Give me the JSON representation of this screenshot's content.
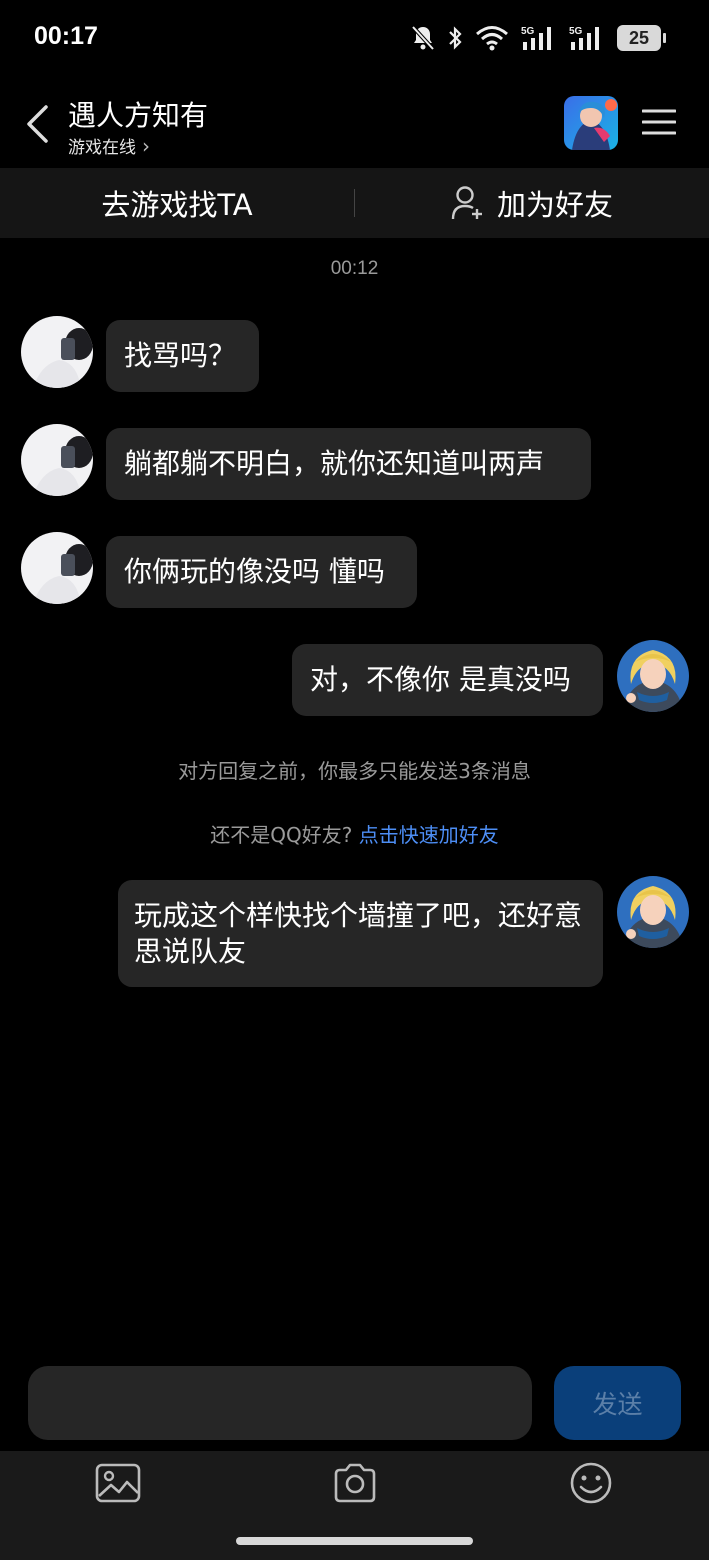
{
  "status_bar": {
    "time": "00:17",
    "battery": "25",
    "icons": [
      "bell-muted-icon",
      "bluetooth-icon",
      "wifi-icon",
      "signal-5g-icon",
      "signal-5g-icon",
      "battery-icon"
    ]
  },
  "header": {
    "title": "遇人方知有",
    "subtitle": "游戏在线",
    "subtitle_chevron": "›"
  },
  "actions": {
    "find_in_game": "去游戏找TA",
    "add_friend": "加为好友"
  },
  "chat": {
    "timestamp": "00:12",
    "messages": [
      {
        "side": "left",
        "text": "找骂吗？"
      },
      {
        "side": "left",
        "text": "躺都躺不明白，就你还知道叫两声"
      },
      {
        "side": "left",
        "text": "你俩玩的像没吗 懂吗"
      },
      {
        "side": "right",
        "text": "对，不像你 是真没吗"
      },
      {
        "side": "right",
        "text": "玩成这个样快找个墙撞了吧，还好意思说队友"
      }
    ],
    "system_limit": "对方回复之前，你最多只能发送3条消息",
    "not_friend_prefix": "还不是QQ好友?",
    "not_friend_link": "点击快速加好友"
  },
  "input": {
    "value": "",
    "send_label": "发送"
  },
  "toolbar": {
    "icons": [
      "image-icon",
      "camera-icon",
      "emoji-icon"
    ]
  },
  "colors": {
    "background": "#000000",
    "bubble": "#262626",
    "link": "#4d8ef5",
    "send_button": "#0a3f7a"
  }
}
